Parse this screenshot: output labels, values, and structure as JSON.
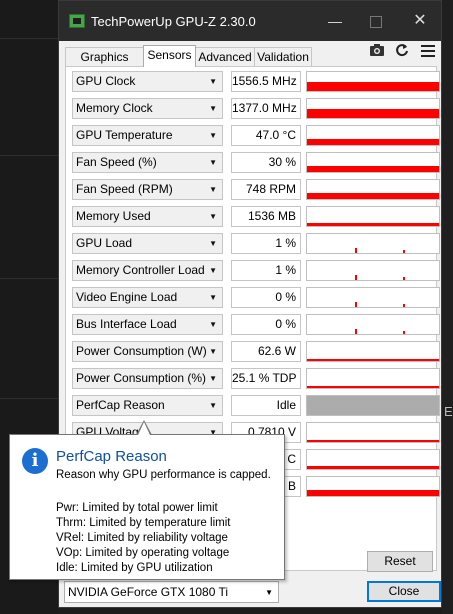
{
  "window": {
    "title": "TechPowerUp GPU-Z 2.30.0",
    "min_glyph": "—",
    "close_glyph": "✕"
  },
  "tabs": [
    {
      "label": "Graphics Card",
      "active": false
    },
    {
      "label": "Sensors",
      "active": true
    },
    {
      "label": "Advanced",
      "active": false
    },
    {
      "label": "Validation",
      "active": false
    }
  ],
  "toolbar": {
    "camera_icon": "camera-icon",
    "refresh_icon": "refresh-icon",
    "menu_icon": "hamburger-menu-icon"
  },
  "sensors": [
    {
      "label": "GPU Clock",
      "value": "1556.5 MHz",
      "fill": 0.45
    },
    {
      "label": "Memory Clock",
      "value": "1377.0 MHz",
      "fill": 0.45
    },
    {
      "label": "GPU Temperature",
      "value": "47.0 °C",
      "fill": 0.3
    },
    {
      "label": "Fan Speed (%)",
      "value": "30 %",
      "fill": 0.3
    },
    {
      "label": "Fan Speed (RPM)",
      "value": "748 RPM",
      "fill": 0.3
    },
    {
      "label": "Memory Used",
      "value": "1536 MB",
      "fill": 0.12
    },
    {
      "label": "GPU Load",
      "value": "1 %",
      "fill": 0.0
    },
    {
      "label": "Memory Controller Load",
      "value": "1 %",
      "fill": 0.0
    },
    {
      "label": "Video Engine Load",
      "value": "0 %",
      "fill": 0.0
    },
    {
      "label": "Bus Interface Load",
      "value": "0 %",
      "fill": 0.0
    },
    {
      "label": "Power Consumption (W)",
      "value": "62.6 W",
      "fill": 0.1
    },
    {
      "label": "Power Consumption (%)",
      "value": "25.1 % TDP",
      "fill": 0.1
    },
    {
      "label": "PerfCap Reason",
      "value": "Idle",
      "fill": 1.0
    },
    {
      "label": "GPU Voltage",
      "value": "0.7810 V",
      "fill": 0.1
    },
    {
      "label": "",
      "value": "C",
      "fill": 0.15
    },
    {
      "label": "",
      "value": "B",
      "fill": 0.3
    }
  ],
  "reset_label": "Reset",
  "gpu_select": "NVIDIA GeForce GTX 1080 Ti",
  "close_label": "Close",
  "tooltip": {
    "icon": "i",
    "title": "PerfCap Reason",
    "description": "Reason why GPU performance is capped.",
    "lines": [
      "Pwr: Limited by total power limit",
      "Thrm: Limited by temperature limit",
      "VRel: Limited by reliability voltage",
      "VOp: Limited by operating voltage",
      "Idle: Limited by GPU utilization"
    ]
  },
  "background_edge_text": "E",
  "colors": {
    "graph": "#ff0000",
    "perfcap_idle": "#acacac",
    "accent": "#0078d7",
    "info": "#1c6fd1"
  }
}
